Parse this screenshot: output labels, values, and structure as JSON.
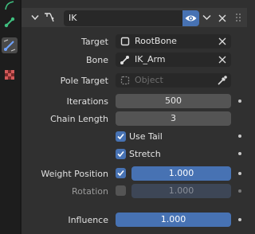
{
  "constraint": {
    "name": "IK"
  },
  "target": {
    "label": "Target",
    "value": "RootBone"
  },
  "bone": {
    "label": "Bone",
    "value": "IK_Arm"
  },
  "pole_target": {
    "label": "Pole Target",
    "placeholder": "Object"
  },
  "iterations": {
    "label": "Iterations",
    "value": "500"
  },
  "chain_length": {
    "label": "Chain Length",
    "value": "3"
  },
  "use_tail": {
    "label": "Use Tail",
    "checked": true
  },
  "stretch": {
    "label": "Stretch",
    "checked": true
  },
  "weight_position": {
    "label": "Weight Position",
    "checked": true,
    "value": "1.000"
  },
  "rotation": {
    "label": "Rotation",
    "checked": false,
    "value": "1.000"
  },
  "influence": {
    "label": "Influence",
    "value": "1.000"
  },
  "colors": {
    "accent": "#4772b3",
    "panel": "#303030",
    "field": "#545454"
  }
}
